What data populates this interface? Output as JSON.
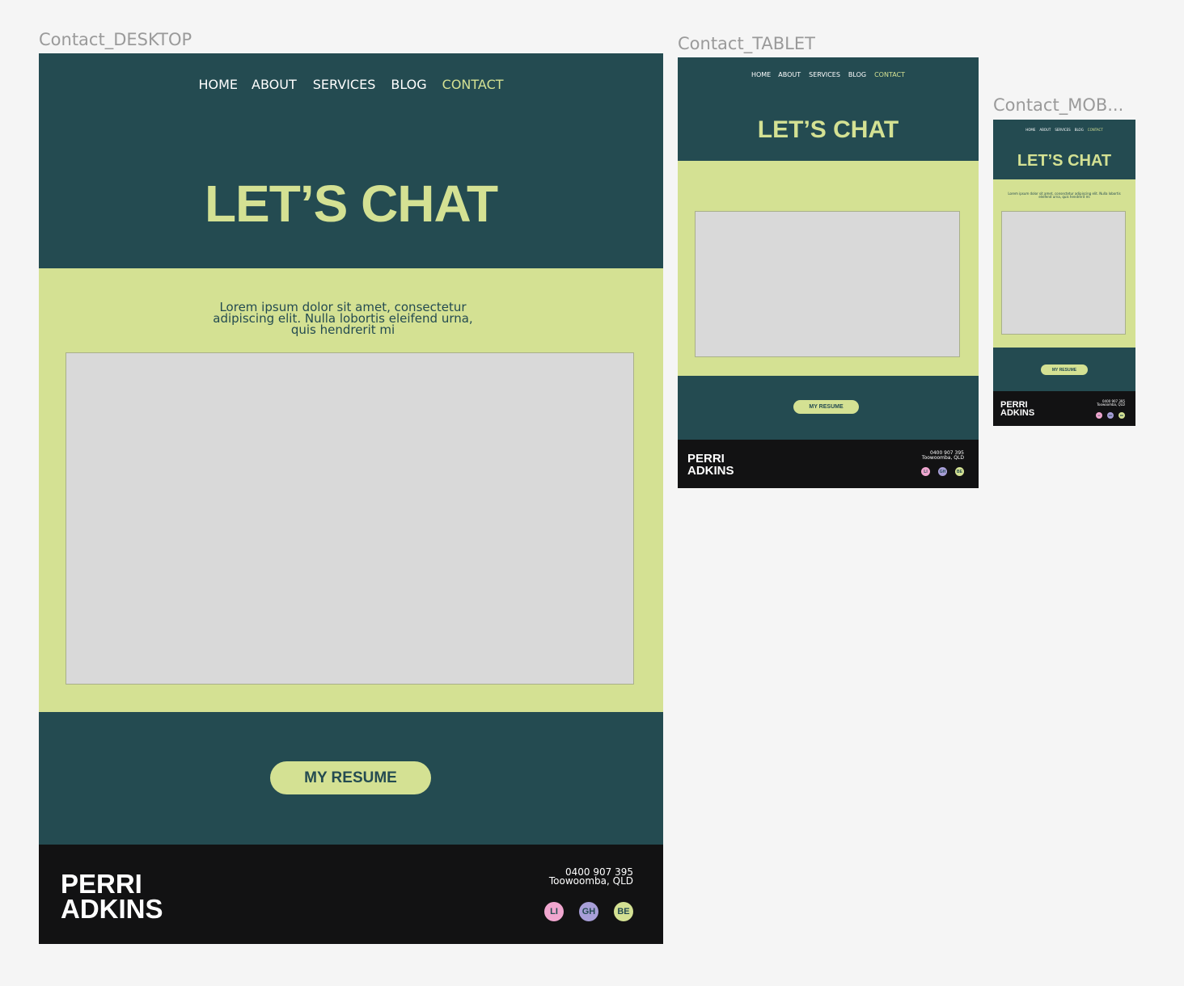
{
  "frames": {
    "desktop": {
      "label": "Contact_DESKTOP"
    },
    "tablet": {
      "label": "Contact_TABLET"
    },
    "mobile": {
      "label": "Contact_MOB..."
    }
  },
  "nav": {
    "home": "HOME",
    "about": "ABOUT",
    "services": "SERVICES",
    "blog": "BLOG",
    "contact": "CONTACT"
  },
  "hero": {
    "title": "LET’S CHAT"
  },
  "intro": {
    "text": "Lorem ipsum dolor sit amet, consectetur adipiscing elit. Nulla lobortis eleifend urna, quis hendrerit mi"
  },
  "cta": {
    "resume_label": "MY RESUME"
  },
  "footer": {
    "name_line1": "PERRI",
    "name_line2": "ADKINS",
    "phone": "0400 907 395",
    "location": "Toowoomba, QLD",
    "socials": [
      {
        "label": "LI",
        "icon": "linkedin-icon",
        "color": "#f0a6cf"
      },
      {
        "label": "GH",
        "icon": "github-icon",
        "color": "#a89fd8"
      },
      {
        "label": "BE",
        "icon": "behance-icon",
        "color": "#d4e193"
      }
    ]
  },
  "colors": {
    "dark_teal": "#244b51",
    "lime": "#d4e193",
    "black": "#121213",
    "placeholder_gray": "#d9d9d9"
  }
}
